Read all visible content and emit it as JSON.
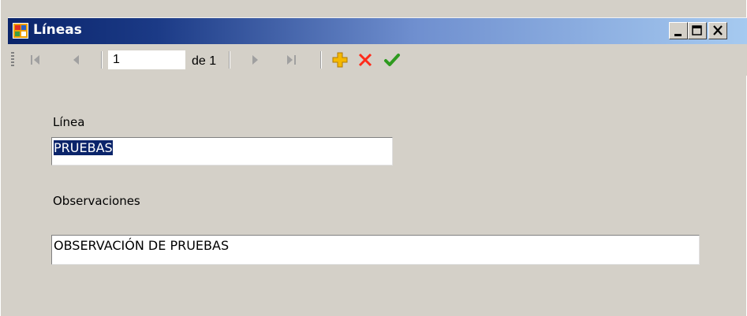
{
  "window": {
    "title": "Líneas",
    "controls": {
      "minimize": "minimize",
      "maximize": "maximize",
      "close": "close"
    }
  },
  "navigator": {
    "position_value": "1",
    "count_label": "de 1",
    "buttons": [
      "move-first",
      "move-previous",
      "move-next",
      "move-last",
      "add-new",
      "delete",
      "save"
    ],
    "colors": {
      "add": "#f5b800",
      "delete": "#ff2a1a",
      "save": "#2e9a1f",
      "disabled": "#a0a0a0"
    }
  },
  "form": {
    "linea_label": "Línea",
    "linea_value": "PRUEBAS",
    "observaciones_label": "Observaciones",
    "observaciones_value": "OBSERVACIÓN DE PRUEBAS"
  }
}
